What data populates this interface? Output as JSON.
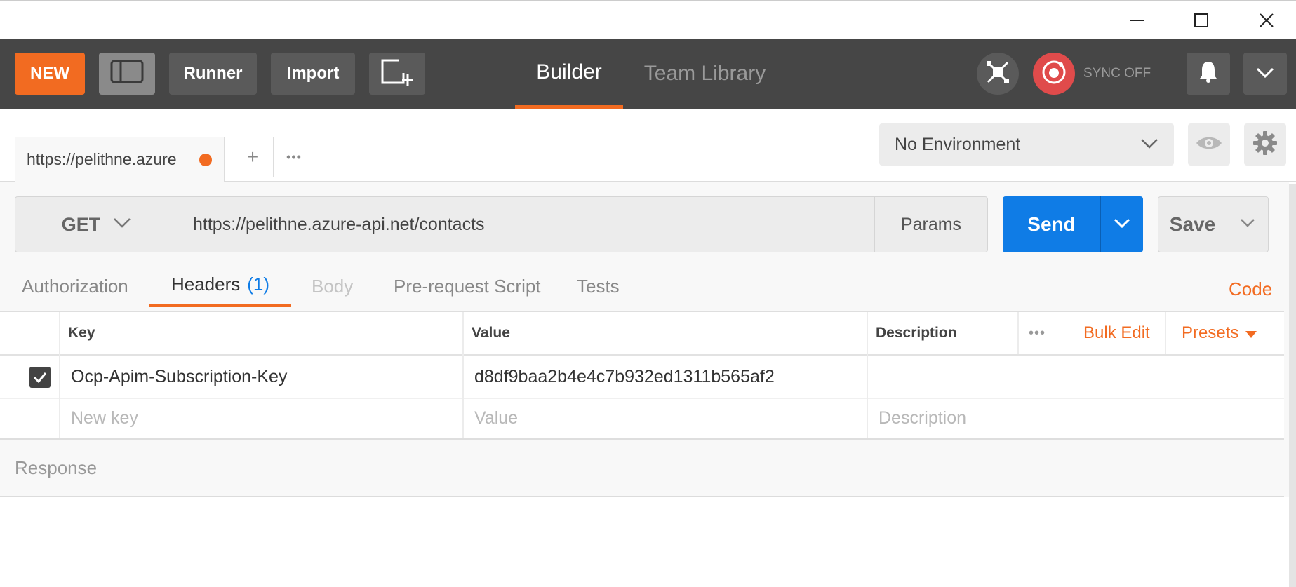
{
  "toolbar": {
    "new_label": "NEW",
    "runner_label": "Runner",
    "import_label": "Import",
    "tabs": [
      "Builder",
      "Team Library"
    ],
    "sync_label": "SYNC OFF",
    "accent": "#f26b21"
  },
  "request_tab": {
    "title": "https://pelithne.azure",
    "add_label": "+",
    "more_label": "•••"
  },
  "environment": {
    "selected": "No Environment"
  },
  "request": {
    "method": "GET",
    "url": "https://pelithne.azure-api.net/contacts",
    "params_label": "Params",
    "send_label": "Send",
    "save_label": "Save",
    "send_color": "#0f7ce6"
  },
  "subtabs": {
    "authorization": "Authorization",
    "headers": "Headers",
    "headers_count": "(1)",
    "body": "Body",
    "prerequest": "Pre-request Script",
    "tests": "Tests",
    "code": "Code"
  },
  "headers_table": {
    "columns": {
      "key": "Key",
      "value": "Value",
      "description": "Description"
    },
    "more_label": "•••",
    "bulk_edit_label": "Bulk Edit",
    "presets_label": "Presets",
    "rows": [
      {
        "checked": true,
        "key": "Ocp-Apim-Subscription-Key",
        "value": "d8df9baa2b4e4c7b932ed1311b565af2",
        "description": ""
      }
    ],
    "new_row": {
      "key_placeholder": "New key",
      "value_placeholder": "Value",
      "description_placeholder": "Description"
    }
  },
  "response": {
    "label": "Response"
  }
}
